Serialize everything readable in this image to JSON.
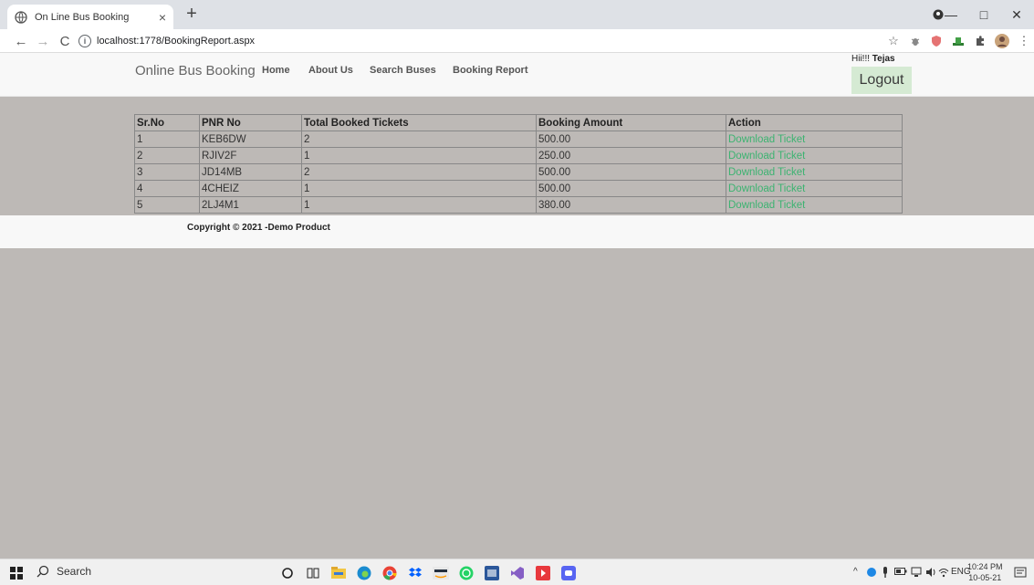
{
  "browser": {
    "tab_title": "On Line Bus Booking",
    "tab_close": "×",
    "new_tab": "+",
    "url": "localhost:1778/BookingReport.aspx",
    "info_glyph": "i",
    "back": "←",
    "forward": "→",
    "reload": "C",
    "star": "☆",
    "win_min": "—",
    "win_max": "□",
    "win_close": "✕",
    "menu": "⋮"
  },
  "header": {
    "brand": "Online Bus Booking",
    "nav": [
      "Home",
      "About Us",
      "Search Buses",
      "Booking Report"
    ],
    "greeting_prefix": "Hii!!! ",
    "user_name": "Tejas",
    "logout": "Logout"
  },
  "table": {
    "columns": [
      "Sr.No",
      "PNR No",
      "Total Booked Tickets",
      "Booking Amount",
      "Action"
    ],
    "rows": [
      [
        "1",
        "KEB6DW",
        "2",
        "500.00",
        "Download Ticket"
      ],
      [
        "2",
        "RJIV2F",
        "1",
        "250.00",
        "Download Ticket"
      ],
      [
        "3",
        "JD14MB",
        "2",
        "500.00",
        "Download Ticket"
      ],
      [
        "4",
        "4CHEIZ",
        "1",
        "500.00",
        "Download Ticket"
      ],
      [
        "5",
        "2LJ4M1",
        "1",
        "380.00",
        "Download Ticket"
      ]
    ]
  },
  "footer": {
    "copyright": "Copyright © 2021 -Demo Product"
  },
  "taskbar": {
    "search_label": "Search",
    "language": "ENG",
    "time": "10:24 PM",
    "date": "10-05-21",
    "icons": [
      "windows-start-icon",
      "search-icon",
      "cortana-icon",
      "task-view-icon",
      "file-explorer-icon",
      "edge-icon",
      "chrome-icon",
      "dropbox-icon",
      "amazon-icon",
      "whatsapp-icon",
      "word-icon",
      "visual-studio-icon",
      "media-icon",
      "discord-icon"
    ]
  },
  "colors": {
    "link_green": "#3cb371",
    "page_bg": "#bdb9b6",
    "logout_bg": "#d5ead3"
  }
}
